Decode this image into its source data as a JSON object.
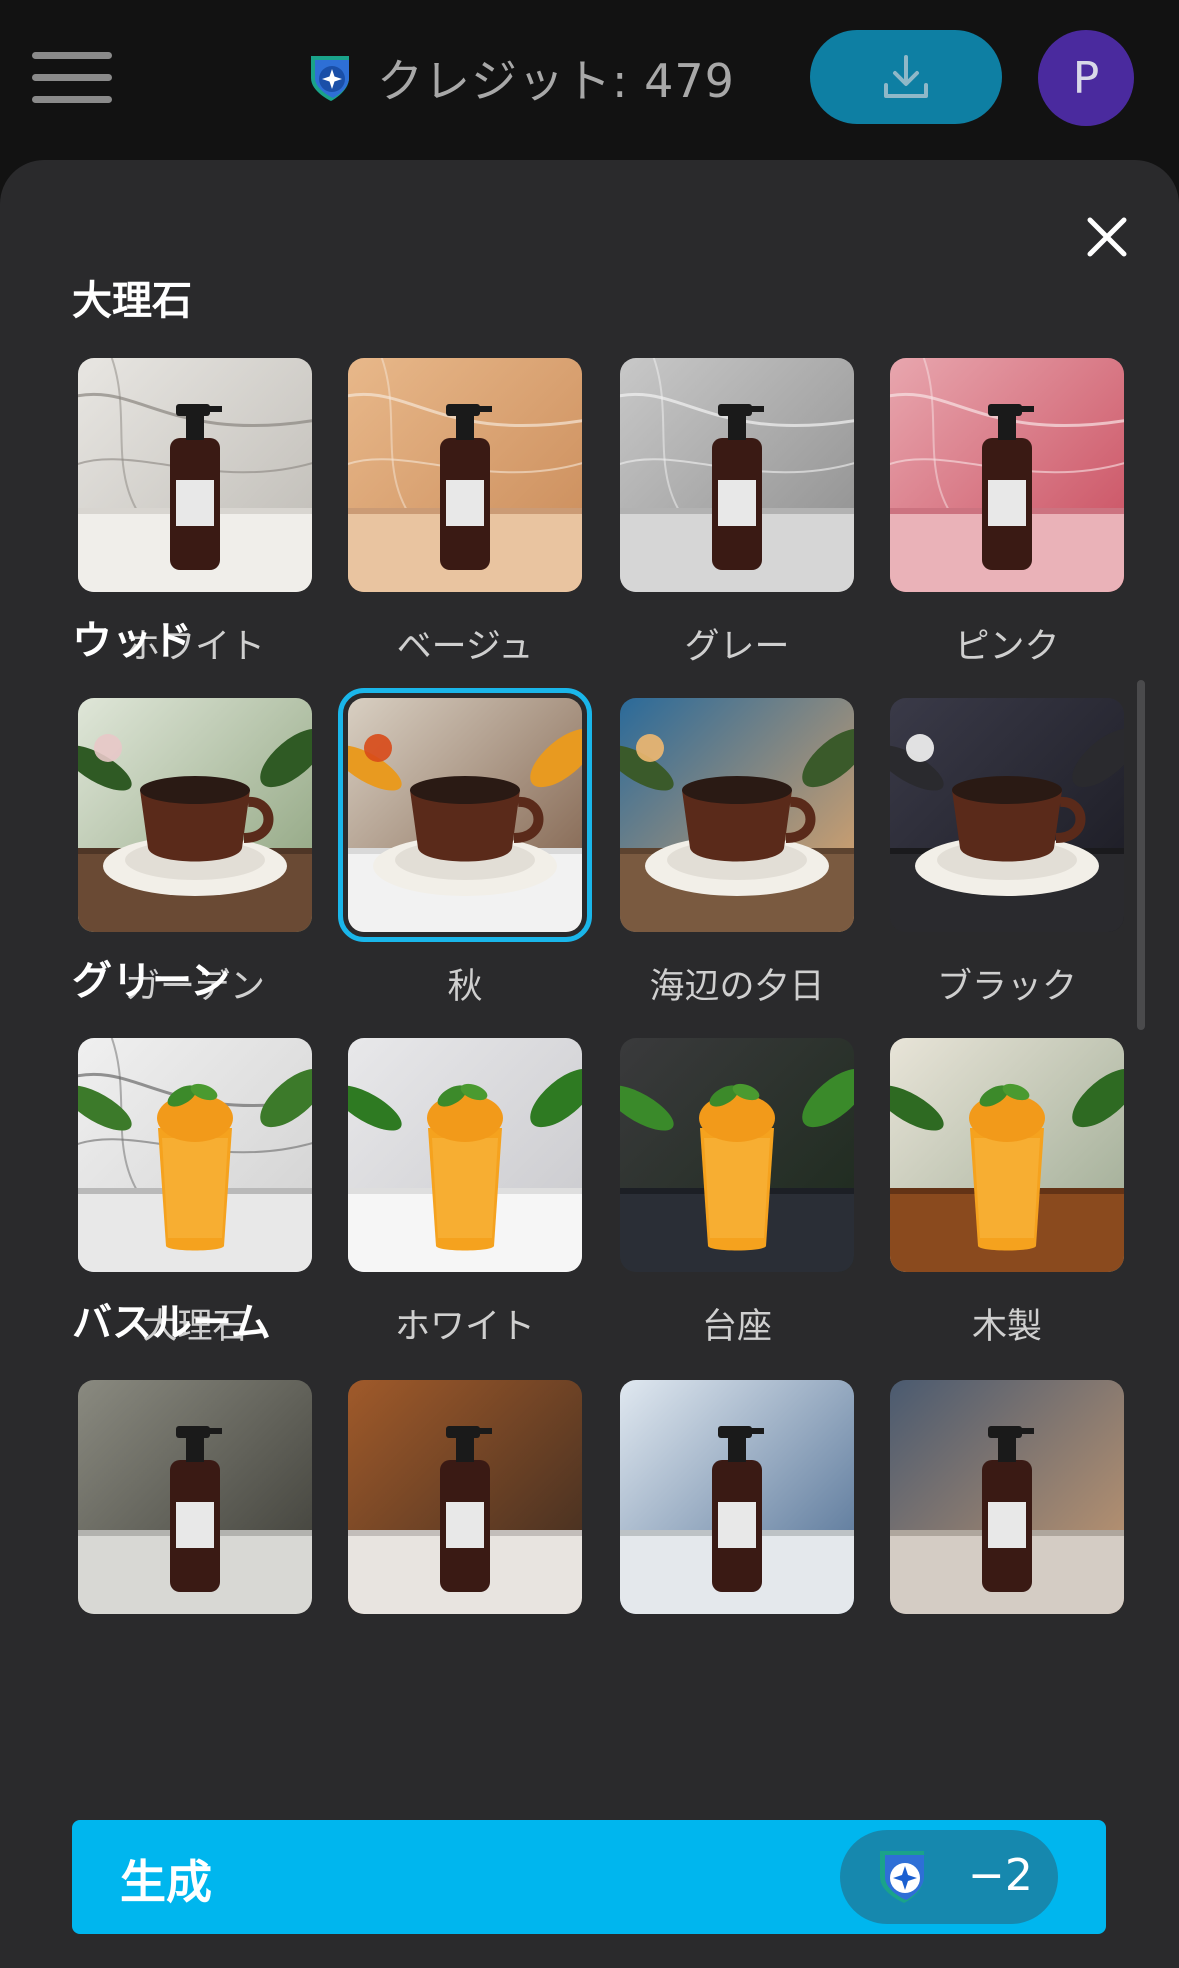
{
  "header": {
    "credits_text": "クレジット: 479",
    "avatar_letter": "P"
  },
  "sections": [
    {
      "title": "大理石",
      "items": [
        {
          "label": "ホワイト",
          "subject": "soap-bottle",
          "bg": "white-marble"
        },
        {
          "label": "ベージュ",
          "subject": "soap-bottle",
          "bg": "beige-marble"
        },
        {
          "label": "グレー",
          "subject": "soap-bottle",
          "bg": "grey-marble"
        },
        {
          "label": "ピンク",
          "subject": "soap-bottle",
          "bg": "pink-marble"
        }
      ]
    },
    {
      "title": "ウッド",
      "items": [
        {
          "label": "ガーデン",
          "subject": "coffee-cup",
          "bg": "garden"
        },
        {
          "label": "秋",
          "subject": "coffee-cup",
          "bg": "autumn",
          "selected": true
        },
        {
          "label": "海辺の夕日",
          "subject": "coffee-cup",
          "bg": "seaside-sunset"
        },
        {
          "label": "ブラック",
          "subject": "coffee-cup",
          "bg": "black"
        }
      ]
    },
    {
      "title": "グリーン",
      "items": [
        {
          "label": "大理石",
          "subject": "mango-drink",
          "bg": "green-marble"
        },
        {
          "label": "ホワイト",
          "subject": "mango-drink",
          "bg": "green-white"
        },
        {
          "label": "台座",
          "subject": "mango-drink",
          "bg": "pedestal"
        },
        {
          "label": "木製",
          "subject": "mango-drink",
          "bg": "wooden"
        }
      ]
    },
    {
      "title": "バスルーム",
      "items": [
        {
          "label": "",
          "subject": "soap-bottle",
          "bg": "bath-1"
        },
        {
          "label": "",
          "subject": "soap-bottle",
          "bg": "bath-2"
        },
        {
          "label": "",
          "subject": "soap-bottle",
          "bg": "bath-3"
        },
        {
          "label": "",
          "subject": "soap-bottle",
          "bg": "bath-4"
        }
      ]
    }
  ],
  "generate": {
    "label": "生成",
    "cost": "−2"
  },
  "colors": {
    "accent": "#00b6ee",
    "panel": "#2a2a2c",
    "topbar": "#121212",
    "selected_outline": "#1ab6ea"
  }
}
